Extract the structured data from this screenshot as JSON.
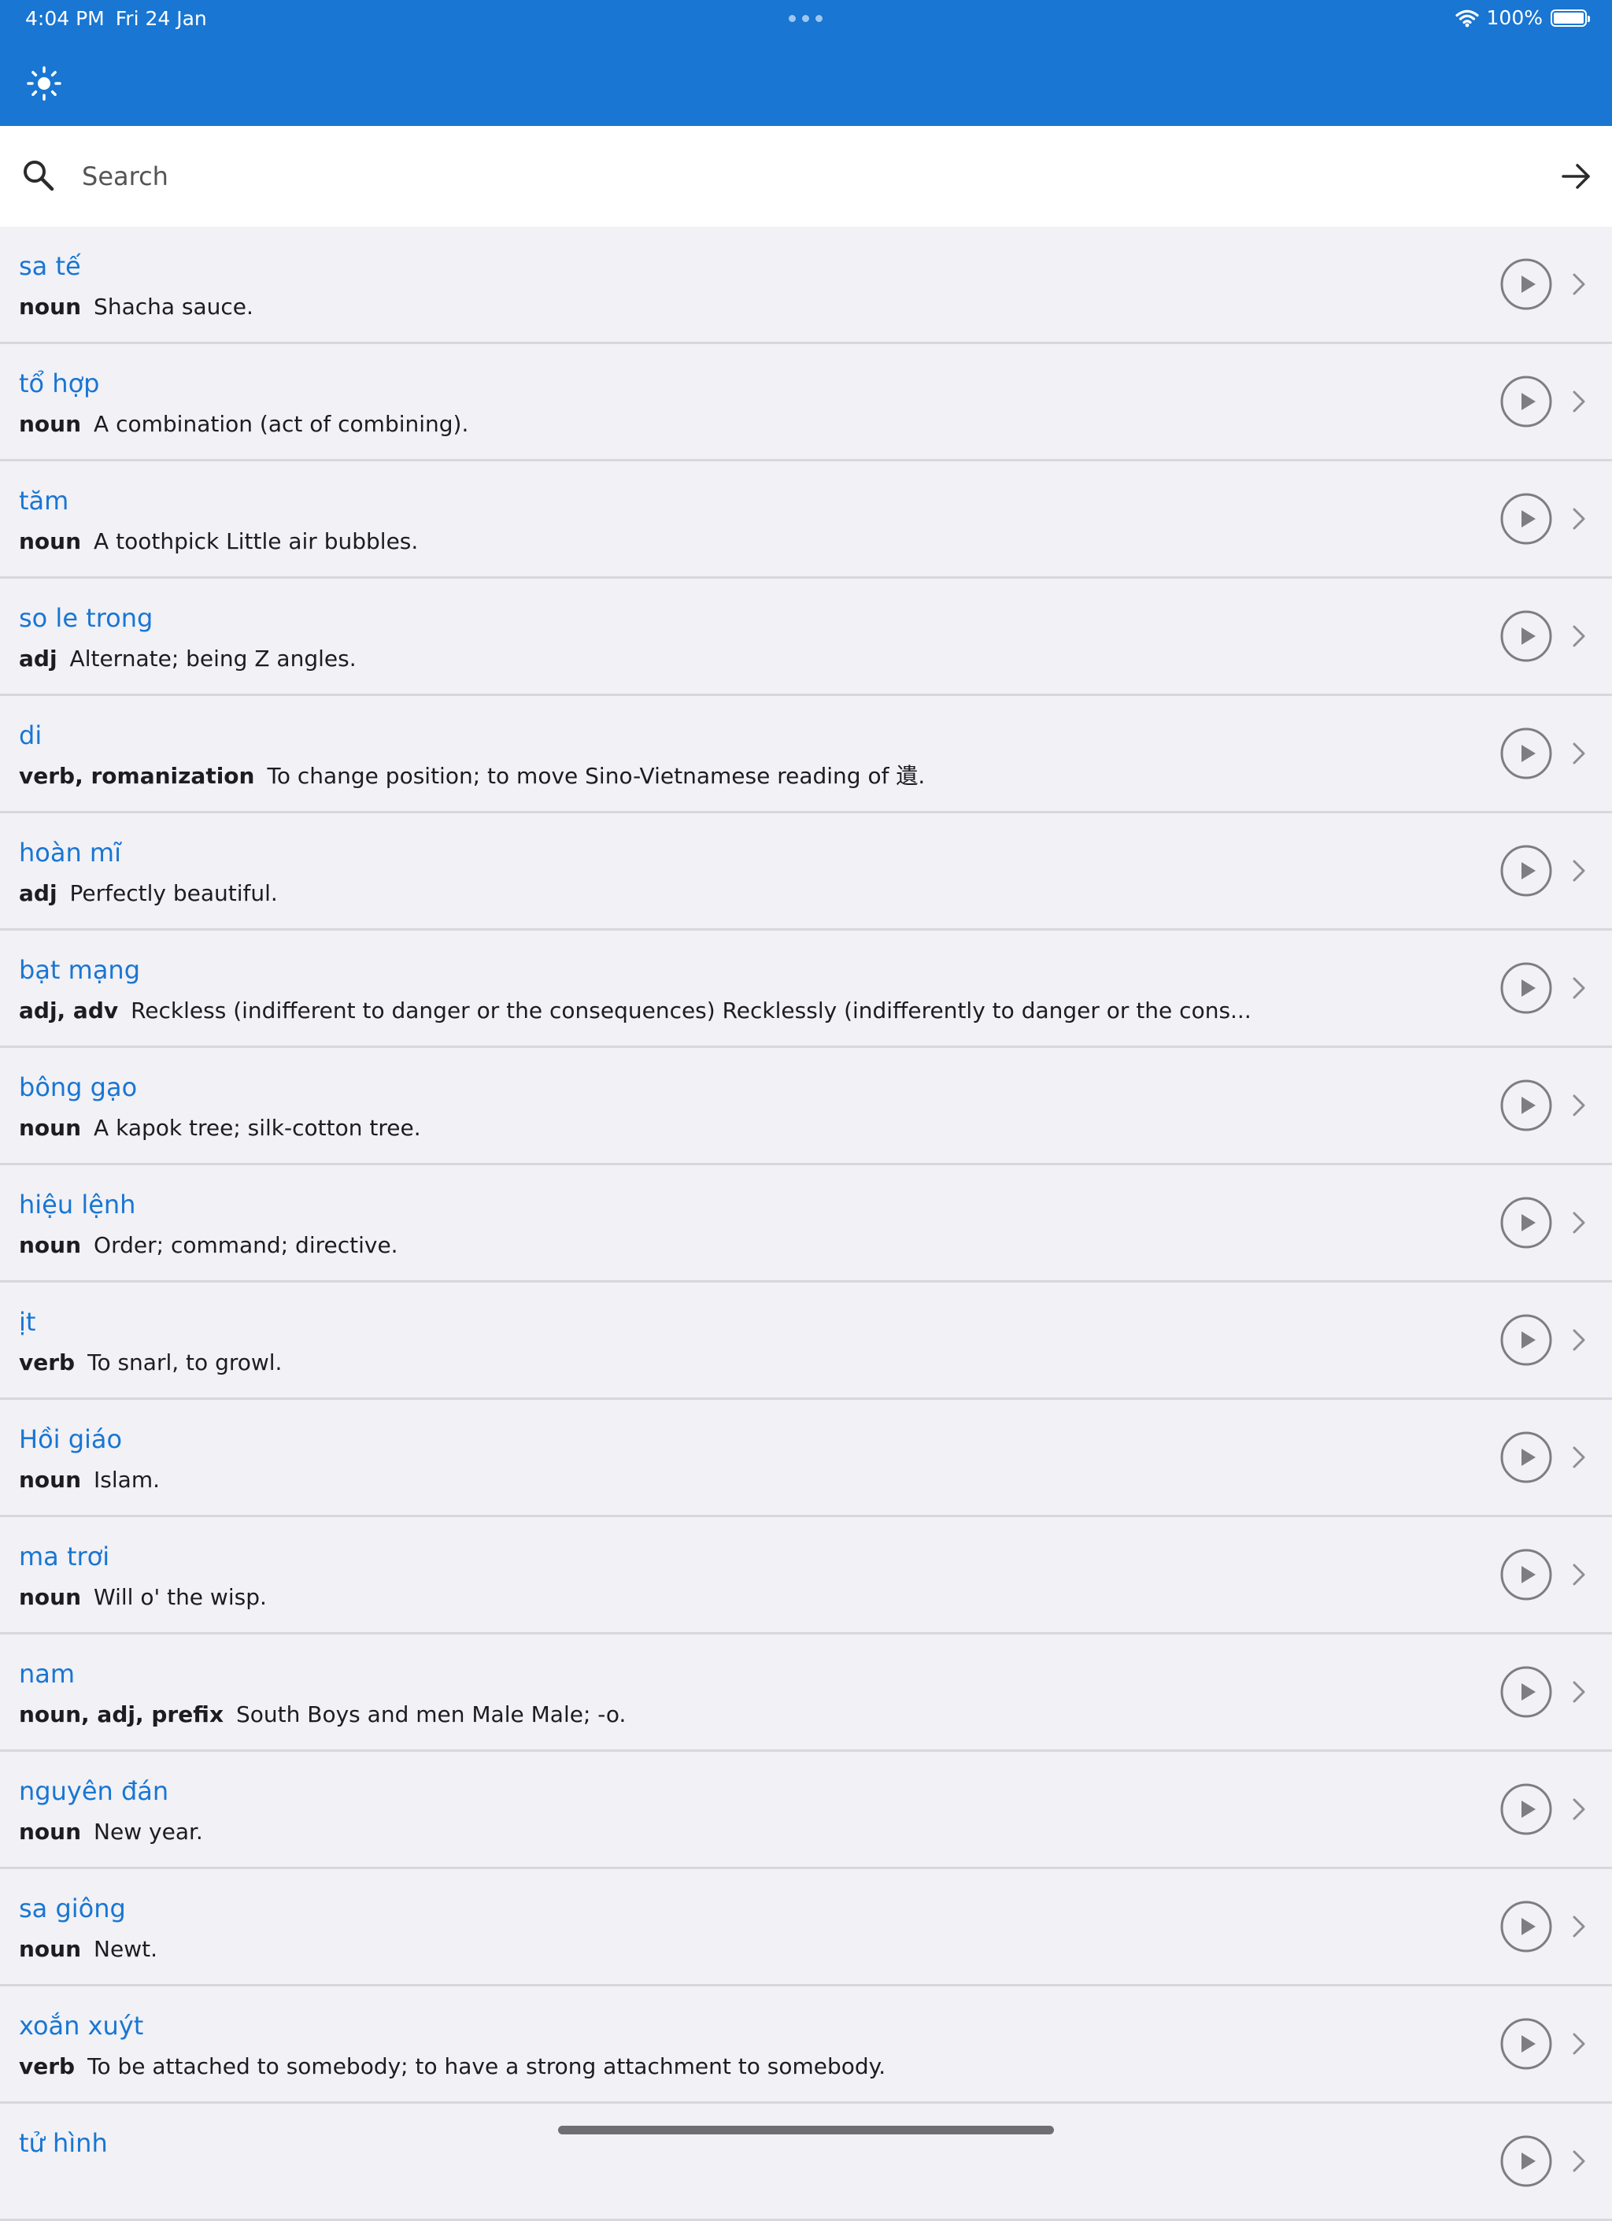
{
  "status_bar": {
    "time": "4:04 PM",
    "date": "Fri 24 Jan",
    "battery": "100%",
    "battery_level": 1.0
  },
  "header": {
    "theme_icon": "sun-icon",
    "color": "#1976d2"
  },
  "search": {
    "placeholder": "Search",
    "value": "",
    "icon": "search-icon",
    "submit_icon": "arrow-right-icon"
  },
  "colors": {
    "accent": "#1976d2",
    "background": "#f1f1f6",
    "divider": "#d8d8dc"
  },
  "entries": [
    {
      "word": "sa tế",
      "pos": "noun",
      "definition": "Shacha sauce."
    },
    {
      "word": "tổ hợp",
      "pos": "noun",
      "definition": "A combination (act of combining)."
    },
    {
      "word": "tăm",
      "pos": "noun",
      "definition": "A toothpick Little air bubbles."
    },
    {
      "word": "so le trong",
      "pos": "adj",
      "definition": "Alternate; being Z angles."
    },
    {
      "word": "di",
      "pos": "verb, romanization",
      "definition": "To change position; to move Sino-Vietnamese reading of 遺."
    },
    {
      "word": "hoàn mĩ",
      "pos": "adj",
      "definition": "Perfectly beautiful."
    },
    {
      "word": "bạt mạng",
      "pos": "adj, adv",
      "definition": "Reckless (indifferent to danger or the consequences) Recklessly (indifferently to danger or the cons..."
    },
    {
      "word": "bông gạo",
      "pos": "noun",
      "definition": "A kapok tree; silk-cotton tree."
    },
    {
      "word": "hiệu lệnh",
      "pos": "noun",
      "definition": "Order; command; directive."
    },
    {
      "word": "ịt",
      "pos": "verb",
      "definition": "To snarl, to growl."
    },
    {
      "word": "Hồi giáo",
      "pos": "noun",
      "definition": "Islam."
    },
    {
      "word": "ma trơi",
      "pos": "noun",
      "definition": "Will o' the wisp."
    },
    {
      "word": "nam",
      "pos": "noun, adj, prefix",
      "definition": "South Boys and men Male Male; -o."
    },
    {
      "word": "nguyên đán",
      "pos": "noun",
      "definition": "New year."
    },
    {
      "word": "sa giông",
      "pos": "noun",
      "definition": "Newt."
    },
    {
      "word": "xoắn xuýt",
      "pos": "verb",
      "definition": "To be attached to somebody; to have a strong attachment to somebody."
    },
    {
      "word": "tử hình",
      "pos": "",
      "definition": ""
    }
  ]
}
